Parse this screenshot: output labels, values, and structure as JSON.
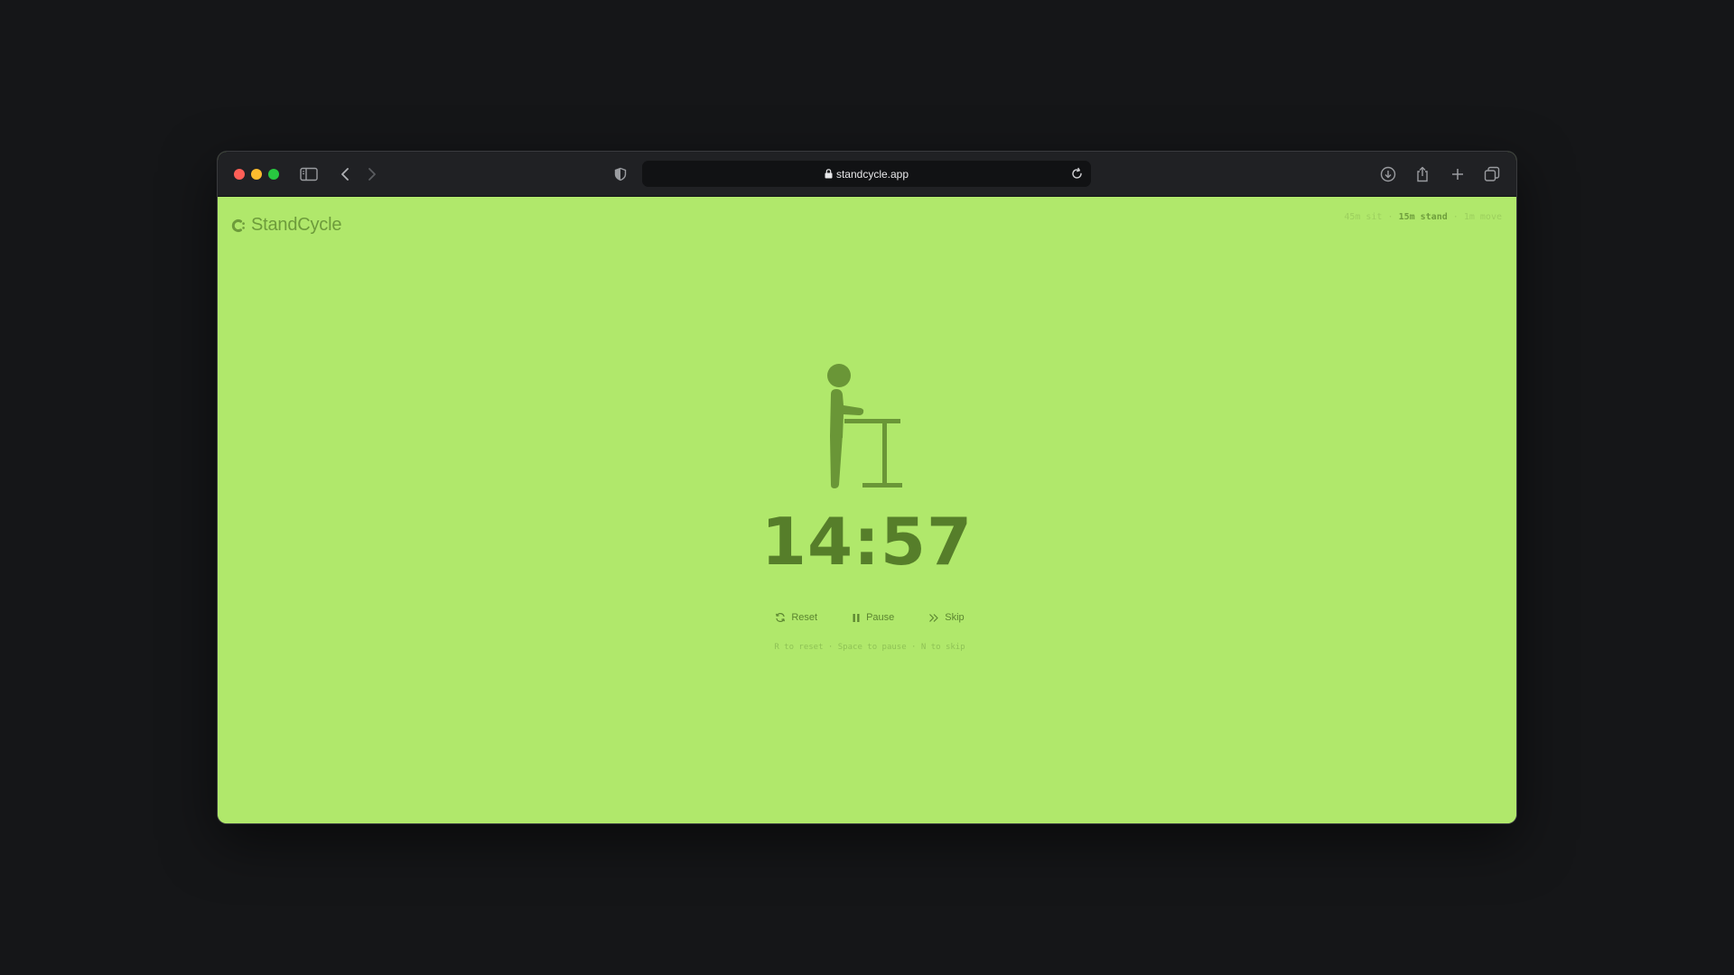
{
  "browser": {
    "url": "standcycle.app"
  },
  "app": {
    "brand": "StandCycle",
    "schedule": {
      "sit": "45m sit",
      "sep1": "·",
      "stand": "15m stand",
      "sep2": "·",
      "move": "1m move",
      "active_phase": "stand"
    },
    "phase_icon": "standing-desk-icon",
    "timer": "14:57",
    "controls": {
      "reset": "Reset",
      "pause": "Pause",
      "skip": "Skip"
    },
    "hints": "R to reset · Space to pause · N to skip"
  },
  "colors": {
    "background": "#b0e86b",
    "figure": "#6a9637",
    "timer": "#567e2a",
    "desktop": "#151618",
    "toolbar": "#202124"
  }
}
